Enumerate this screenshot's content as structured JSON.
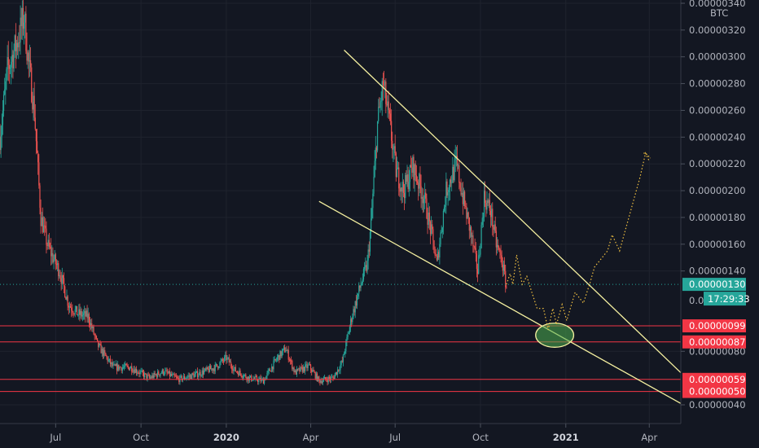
{
  "chart_data": {
    "type": "candlestick",
    "unit_label": "BTC",
    "y_ticks": [
      "0.00000340",
      "0.00000320",
      "0.00000300",
      "0.00000280",
      "0.00000260",
      "0.00000240",
      "0.00000220",
      "0.00000200",
      "0.00000180",
      "0.00000160",
      "0.00000140",
      "0.00000080",
      "0.00000040"
    ],
    "ylim": [
      4e-07,
      3.4e-06
    ],
    "x_ticks": [
      {
        "label": "Jul",
        "date": "2019-07-01",
        "bold": false
      },
      {
        "label": "Oct",
        "date": "2019-10-01",
        "bold": false
      },
      {
        "label": "2020",
        "date": "2020-01-01",
        "bold": true
      },
      {
        "label": "Apr",
        "date": "2020-04-01",
        "bold": false
      },
      {
        "label": "Jul",
        "date": "2020-07-01",
        "bold": false
      },
      {
        "label": "Oct",
        "date": "2020-10-01",
        "bold": false
      },
      {
        "label": "2021",
        "date": "2021-01-01",
        "bold": true
      },
      {
        "label": "Apr",
        "date": "2021-04-01",
        "bold": false
      }
    ],
    "xlim": [
      "2019-05-02",
      "2021-05-05"
    ],
    "current_price": {
      "value": 1.3e-06,
      "label": "0.00000130",
      "countdown": "17:29:33",
      "partial_label": "0.0"
    },
    "level_lines": [
      {
        "value": 9.9e-07,
        "label": "0.00000099"
      },
      {
        "value": 8.7e-07,
        "label": "0.00000087"
      },
      {
        "value": 5.9e-07,
        "label": "0.00000059"
      },
      {
        "value": 5e-07,
        "label": "0.00000050"
      }
    ],
    "trendlines": [
      {
        "from": [
          "2020-05-07",
          3.05e-06
        ],
        "to": [
          "2021-05-05",
          6.4e-07
        ]
      },
      {
        "from": [
          "2020-04-10",
          1.92e-06
        ],
        "to": [
          "2021-05-05",
          4.1e-07
        ]
      }
    ],
    "target_zone": {
      "center": [
        "2020-12-20",
        9.2e-07
      ],
      "value_span": [
        8.3e-07,
        1.01e-06
      ],
      "date_span": [
        "2020-11-30",
        "2021-01-10"
      ]
    },
    "projection": [
      [
        "2020-10-29",
        1.3e-06
      ],
      [
        "2020-11-02",
        1.38e-06
      ],
      [
        "2020-11-05",
        1.3e-06
      ],
      [
        "2020-11-09",
        1.52e-06
      ],
      [
        "2020-11-15",
        1.3e-06
      ],
      [
        "2020-11-20",
        1.36e-06
      ],
      [
        "2020-11-24",
        1.27e-06
      ],
      [
        "2020-12-01",
        1.12e-06
      ],
      [
        "2020-12-08",
        1.12e-06
      ],
      [
        "2020-12-13",
        9.6e-07
      ],
      [
        "2020-12-18",
        1.12e-06
      ],
      [
        "2020-12-22",
        1e-06
      ],
      [
        "2020-12-28",
        1.15e-06
      ],
      [
        "2021-01-02",
        1.03e-06
      ],
      [
        "2021-01-11",
        1.24e-06
      ],
      [
        "2021-01-20",
        1.16e-06
      ],
      [
        "2021-01-27",
        1.31e-06
      ],
      [
        "2021-02-01",
        1.43e-06
      ],
      [
        "2021-02-15",
        1.55e-06
      ],
      [
        "2021-02-20",
        1.67e-06
      ],
      [
        "2021-02-28",
        1.55e-06
      ],
      [
        "2021-03-10",
        1.8e-06
      ],
      [
        "2021-03-22",
        2.1e-06
      ],
      [
        "2021-03-28",
        2.28e-06
      ],
      [
        "2021-04-01",
        2.22e-06
      ]
    ],
    "price_path": [
      [
        "2019-05-02",
        2.4e-06
      ],
      [
        "2019-05-10",
        2.9e-06
      ],
      [
        "2019-05-20",
        3.1e-06
      ],
      [
        "2019-05-28",
        3.3e-06
      ],
      [
        "2019-06-01",
        3e-06
      ],
      [
        "2019-06-08",
        2.6e-06
      ],
      [
        "2019-06-15",
        1.8e-06
      ],
      [
        "2019-06-22",
        1.6e-06
      ],
      [
        "2019-06-28",
        1.5e-06
      ],
      [
        "2019-07-05",
        1.4e-06
      ],
      [
        "2019-07-15",
        1.15e-06
      ],
      [
        "2019-07-25",
        1.08e-06
      ],
      [
        "2019-08-05",
        1.06e-06
      ],
      [
        "2019-08-15",
        8.5e-07
      ],
      [
        "2019-09-01",
        6.8e-07
      ],
      [
        "2019-09-20",
        6.8e-07
      ],
      [
        "2019-10-10",
        6e-07
      ],
      [
        "2019-10-25",
        6.5e-07
      ],
      [
        "2019-11-10",
        5.9e-07
      ],
      [
        "2019-12-01",
        6.3e-07
      ],
      [
        "2019-12-20",
        6.8e-07
      ],
      [
        "2020-01-01",
        7.5e-07
      ],
      [
        "2020-01-10",
        6.6e-07
      ],
      [
        "2020-01-25",
        6e-07
      ],
      [
        "2020-02-10",
        5.8e-07
      ],
      [
        "2020-02-25",
        7.5e-07
      ],
      [
        "2020-03-05",
        8.2e-07
      ],
      [
        "2020-03-15",
        6.4e-07
      ],
      [
        "2020-03-30",
        6.9e-07
      ],
      [
        "2020-04-10",
        5.8e-07
      ],
      [
        "2020-04-25",
        6e-07
      ],
      [
        "2020-05-05",
        7.2e-07
      ],
      [
        "2020-05-15",
        1.05e-06
      ],
      [
        "2020-05-25",
        1.3e-06
      ],
      [
        "2020-06-01",
        1.45e-06
      ],
      [
        "2020-06-05",
        1.75e-06
      ],
      [
        "2020-06-12",
        2.5e-06
      ],
      [
        "2020-06-18",
        2.8e-06
      ],
      [
        "2020-06-25",
        2.5e-06
      ],
      [
        "2020-07-02",
        2.15e-06
      ],
      [
        "2020-07-10",
        2e-06
      ],
      [
        "2020-07-20",
        2.18e-06
      ],
      [
        "2020-08-01",
        1.95e-06
      ],
      [
        "2020-08-10",
        1.65e-06
      ],
      [
        "2020-08-15",
        1.45e-06
      ],
      [
        "2020-08-25",
        2e-06
      ],
      [
        "2020-09-05",
        2.2e-06
      ],
      [
        "2020-09-12",
        1.95e-06
      ],
      [
        "2020-09-20",
        1.7e-06
      ],
      [
        "2020-09-28",
        1.4e-06
      ],
      [
        "2020-10-05",
        1.95e-06
      ],
      [
        "2020-10-12",
        1.85e-06
      ],
      [
        "2020-10-18",
        1.6e-06
      ],
      [
        "2020-10-24",
        1.48e-06
      ],
      [
        "2020-10-29",
        1.28e-06
      ]
    ]
  }
}
